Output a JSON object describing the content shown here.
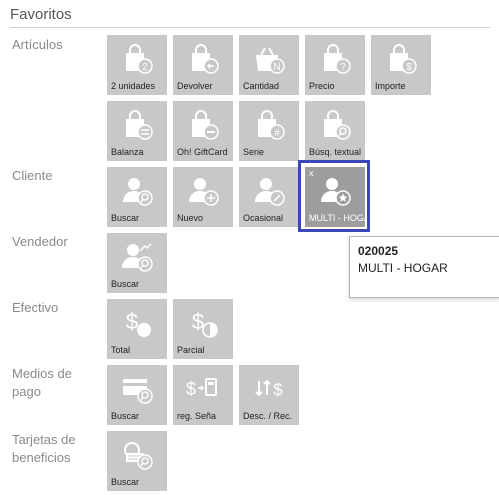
{
  "header": {
    "title": "Favoritos"
  },
  "sections": {
    "articulos": "Artículos",
    "cliente": "Cliente",
    "vendedor": "Vendedor",
    "efectivo": "Efectivo",
    "medios_pago": "Medios de pago",
    "tarjetas": "Tarjetas de beneficios"
  },
  "tiles": {
    "dos_unidades": {
      "label": "2 unidades",
      "icon": "bag-2-icon"
    },
    "devolver": {
      "label": "Devolver",
      "icon": "bag-return-icon"
    },
    "cantidad": {
      "label": "Cantidad",
      "icon": "basket-n-icon"
    },
    "precio": {
      "label": "Precio",
      "icon": "bag-question-icon"
    },
    "importe": {
      "label": "Importe",
      "icon": "bag-dollar-icon"
    },
    "balanza": {
      "label": "Balanza",
      "icon": "bag-scale-icon"
    },
    "giftcard": {
      "label": "Oh! GiftCard",
      "icon": "bag-card-icon"
    },
    "serie": {
      "label": "Serie",
      "icon": "bag-hash-icon"
    },
    "busq_textual": {
      "label": "Búsq. textual",
      "icon": "bag-search-icon"
    },
    "cli_buscar": {
      "label": "Buscar",
      "icon": "user-search-icon"
    },
    "cli_nuevo": {
      "label": "Nuevo",
      "icon": "user-add-icon"
    },
    "cli_ocasional": {
      "label": "Ocasional",
      "icon": "user-pencil-icon"
    },
    "cli_multi": {
      "label": "MULTI - HOGAR",
      "icon": "user-star-icon",
      "remove": "x"
    },
    "vend_buscar": {
      "label": "Buscar",
      "icon": "seller-search-icon"
    },
    "efe_total": {
      "label": "Total",
      "icon": "cash-total-icon"
    },
    "efe_parcial": {
      "label": "Parcial",
      "icon": "cash-partial-icon"
    },
    "mp_buscar": {
      "label": "Buscar",
      "icon": "card-search-icon"
    },
    "mp_sena": {
      "label": "reg. Seña",
      "icon": "cash-deposit-icon"
    },
    "mp_desc": {
      "label": "Desc. / Rec.",
      "icon": "discount-icon"
    },
    "tb_buscar": {
      "label": "Buscar",
      "icon": "benefit-card-search-icon"
    }
  },
  "tooltip": {
    "code": "020025",
    "name": "MULTI - HOGAR"
  },
  "colors": {
    "tile": "#c8c8c8",
    "tile_active": "#9d9d9d",
    "selection": "#3b46b9"
  }
}
